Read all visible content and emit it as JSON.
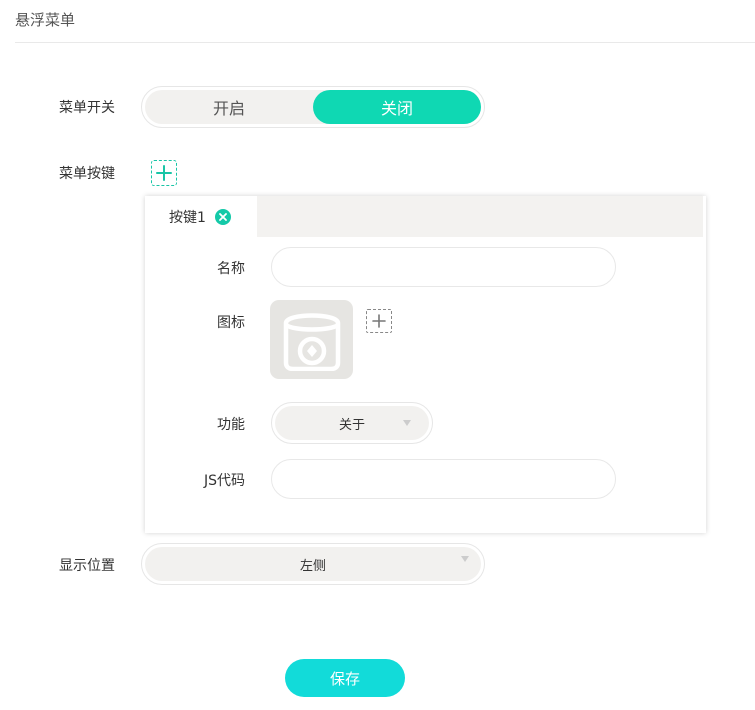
{
  "page": {
    "title": "悬浮菜单"
  },
  "menu_switch": {
    "label": "菜单开关",
    "on_label": "开启",
    "off_label": "关闭",
    "selected": "关闭"
  },
  "menu_buttons": {
    "label": "菜单按键",
    "tabs": [
      {
        "label": "按键1",
        "active": true
      }
    ],
    "form": {
      "name_label": "名称",
      "name_value": "",
      "icon_label": "图标",
      "function_label": "功能",
      "function_value": "关于",
      "js_label": "JS代码",
      "js_value": ""
    }
  },
  "position": {
    "label": "显示位置",
    "value": "左侧"
  },
  "save": {
    "label": "保存"
  },
  "colors": {
    "accent": "#0fd8b3",
    "save": "#12dbd9",
    "tab_close": "#14c9a8"
  }
}
